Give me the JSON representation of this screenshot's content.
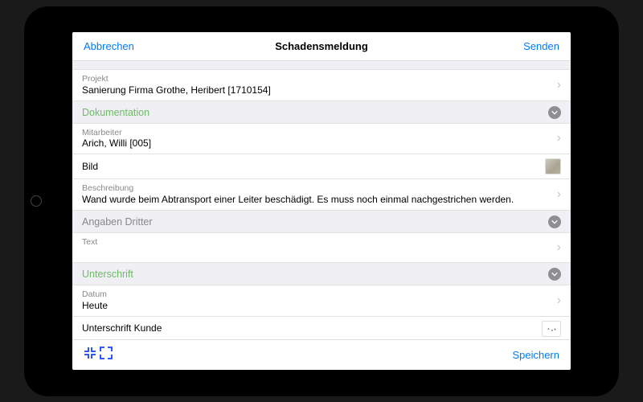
{
  "colors": {
    "accent": "#007aff",
    "section_active": "#6fbb67"
  },
  "navbar": {
    "cancel": "Abbrechen",
    "title": "Schadensmeldung",
    "send": "Senden"
  },
  "project": {
    "label": "Projekt",
    "value": "Sanierung Firma Grothe, Heribert [1710154]"
  },
  "sections": {
    "documentation": {
      "title": "Dokumentation",
      "rows": {
        "employee": {
          "label": "Mitarbeiter",
          "value": "Arich, Willi [005]"
        },
        "image": {
          "label": "Bild"
        },
        "description": {
          "label": "Beschreibung",
          "value": "Wand wurde beim Abtransport einer Leiter beschädigt. Es muss noch einmal nachgestrichen werden."
        }
      }
    },
    "third_party": {
      "title": "Angaben Dritter",
      "rows": {
        "text": {
          "label": "Text",
          "value": ""
        }
      }
    },
    "signature": {
      "title": "Unterschrift",
      "rows": {
        "date": {
          "label": "Datum",
          "value": "Heute"
        },
        "customer_signature": {
          "label": "Unterschrift Kunde"
        }
      }
    }
  },
  "toolbar": {
    "save": "Speichern"
  }
}
